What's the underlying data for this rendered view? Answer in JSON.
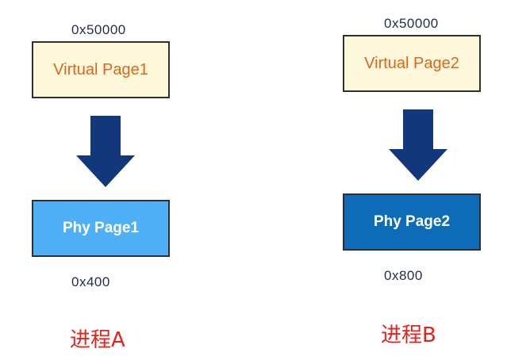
{
  "colors": {
    "virtual_fill": "#fdf8dc",
    "virtual_text": "#d9681e",
    "phy1_fill": "#4fb0f5",
    "phy2_fill": "#0e6bb8",
    "arrow": "#12377a",
    "process_label": "#e0241d",
    "address_text": "#1f2d4a"
  },
  "process_a": {
    "virtual_address": "0x50000",
    "virtual_page": "Virtual Page1",
    "phy_page": "Phy Page1",
    "phy_address": "0x400",
    "label": "进程A"
  },
  "process_b": {
    "virtual_address": "0x50000",
    "virtual_page": "Virtual Page2",
    "phy_page": "Phy Page2",
    "phy_address": "0x800",
    "label": "进程B"
  }
}
